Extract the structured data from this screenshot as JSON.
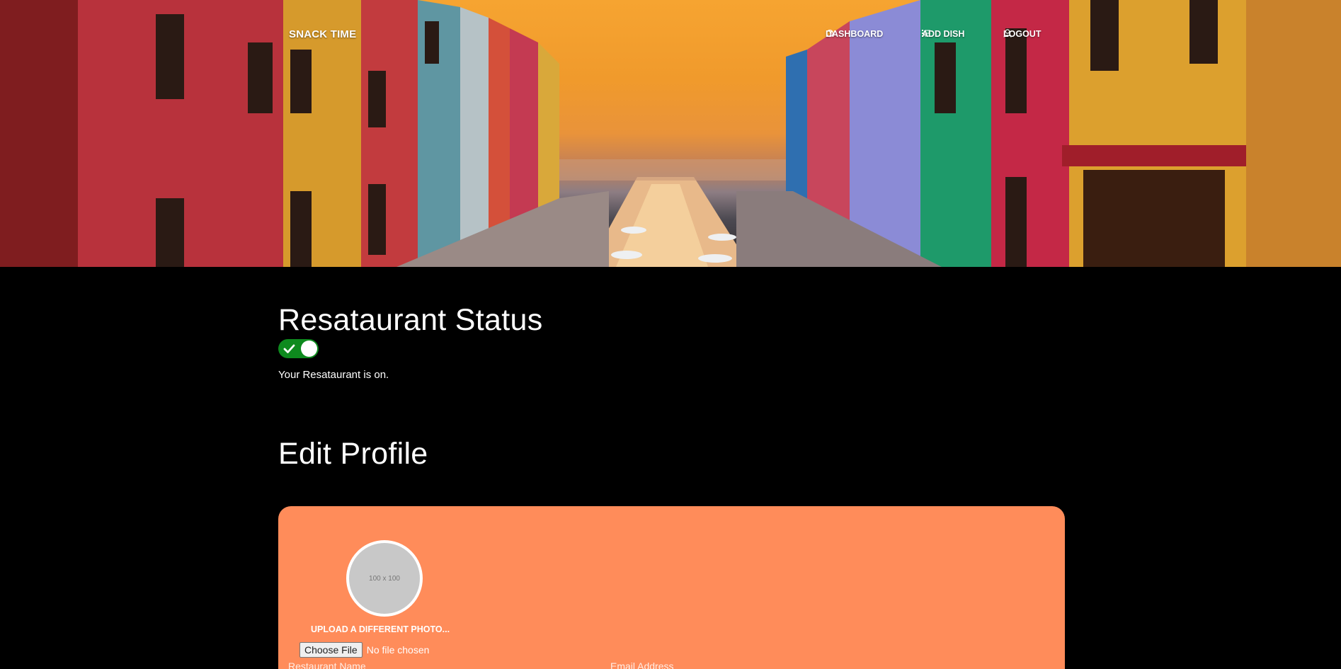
{
  "nav": {
    "brand": "SNACK TIME",
    "items": [
      {
        "label": "DASHBOARD",
        "icon": "dashboard-icon"
      },
      {
        "label": "ADD DISH",
        "icon": "list-icon"
      },
      {
        "label": "LOGOUT",
        "icon": "user-icon"
      }
    ]
  },
  "status": {
    "heading": "Resataurant Status",
    "toggle_on": true,
    "message": "Your Resataurant is on."
  },
  "profile": {
    "heading": "Edit Profile",
    "avatar_placeholder": "100 x 100",
    "upload_label": "UPLOAD A DIFFERENT PHOTO...",
    "choose_file_label": "Choose File",
    "file_status": "No file chosen",
    "fields": {
      "name_label": "Restaurant Name",
      "email_label": "Email Address"
    }
  },
  "colors": {
    "toggle_on": "#0e8a1e",
    "card_bg": "#ff8c5a",
    "page_bg": "#000000"
  }
}
